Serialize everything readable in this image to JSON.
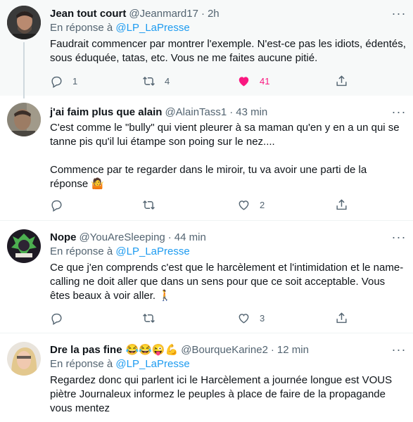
{
  "tweets": [
    {
      "name": "Jean tout court",
      "handle": "@Jeanmard17",
      "time": "2h",
      "reply_prefix": "En réponse à",
      "reply_to": "@LP_LaPresse",
      "text": "Faudrait commencer par montrer l'exemple. N'est-ce pas les idiots, édentés, sous éduquée, tatas, etc. Vous ne me faites aucune pitié.",
      "replies": "1",
      "retweets": "4",
      "likes": "41"
    },
    {
      "name": "j'ai faim plus que alain",
      "handle": "@AlainTass1",
      "time": "43 min",
      "text": "C'est comme le \"bully\" qui vient pleurer à sa maman qu'en y en a un qui se tanne pis qu'il lui étampe son poing sur le nez....\n\nCommence par te regarder dans le miroir, tu va avoir une parti de la réponse 🤷",
      "replies": "",
      "retweets": "",
      "likes": "2"
    },
    {
      "name": "Nope",
      "handle": "@YouAreSleeping",
      "time": "44 min",
      "reply_prefix": "En réponse à",
      "reply_to": "@LP_LaPresse",
      "text": "Ce que j'en comprends c'est que le harcèlement et l'intimidation et le name-calling ne doit aller que dans un sens pour que ce soit acceptable. Vous êtes beaux à voir aller. 🚶",
      "replies": "",
      "retweets": "",
      "likes": "3"
    },
    {
      "name": "Dre la pas fine",
      "name_emojis": "😂😂😜💪",
      "handle": "@BourqueKarine2",
      "time": "12 min",
      "reply_prefix": "En réponse à",
      "reply_to": "@LP_LaPresse",
      "text": "Regardez donc qui parlent ici le Harcèlement a journée longue est VOUS piètre Journaleux informez le peuples à place de faire de la propagande vous mentez"
    }
  ],
  "separator": "·",
  "more_glyph": "···",
  "colors": {
    "accent": "#1d9bf0",
    "like": "#f91880",
    "muted": "#536471"
  }
}
